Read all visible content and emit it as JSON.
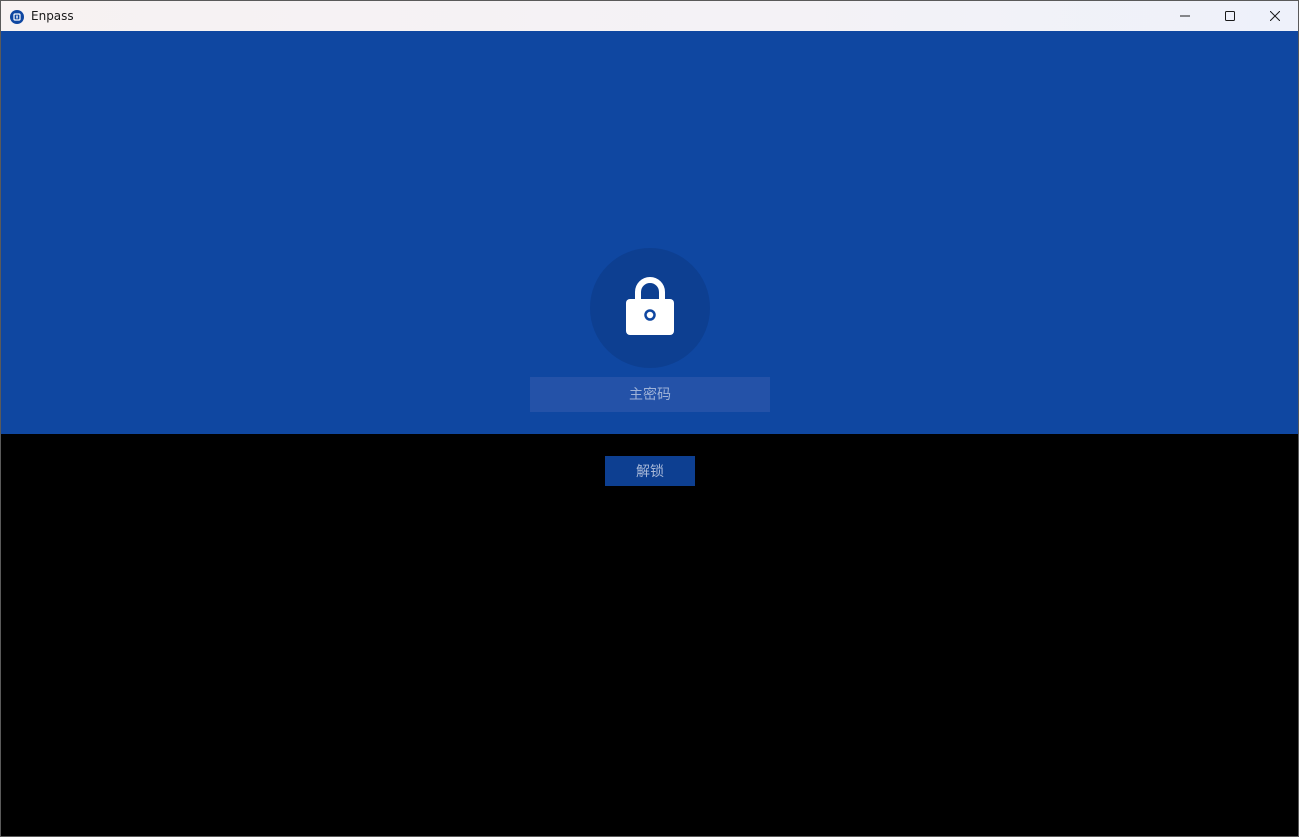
{
  "window": {
    "title": "Enpass",
    "app_icon": "enpass-logo-icon",
    "controls": {
      "minimize_icon": "minimize-icon",
      "maximize_icon": "maximize-icon",
      "close_icon": "close-icon"
    }
  },
  "lock_screen": {
    "lock_icon": "padlock-icon",
    "password": {
      "placeholder": "主密码",
      "value": ""
    },
    "unlock_label": "解锁"
  },
  "colors": {
    "header_blue": "#0f47a1",
    "circle_blue": "#0d3f91",
    "field_blue": "#2452a8",
    "background": "#000000"
  }
}
